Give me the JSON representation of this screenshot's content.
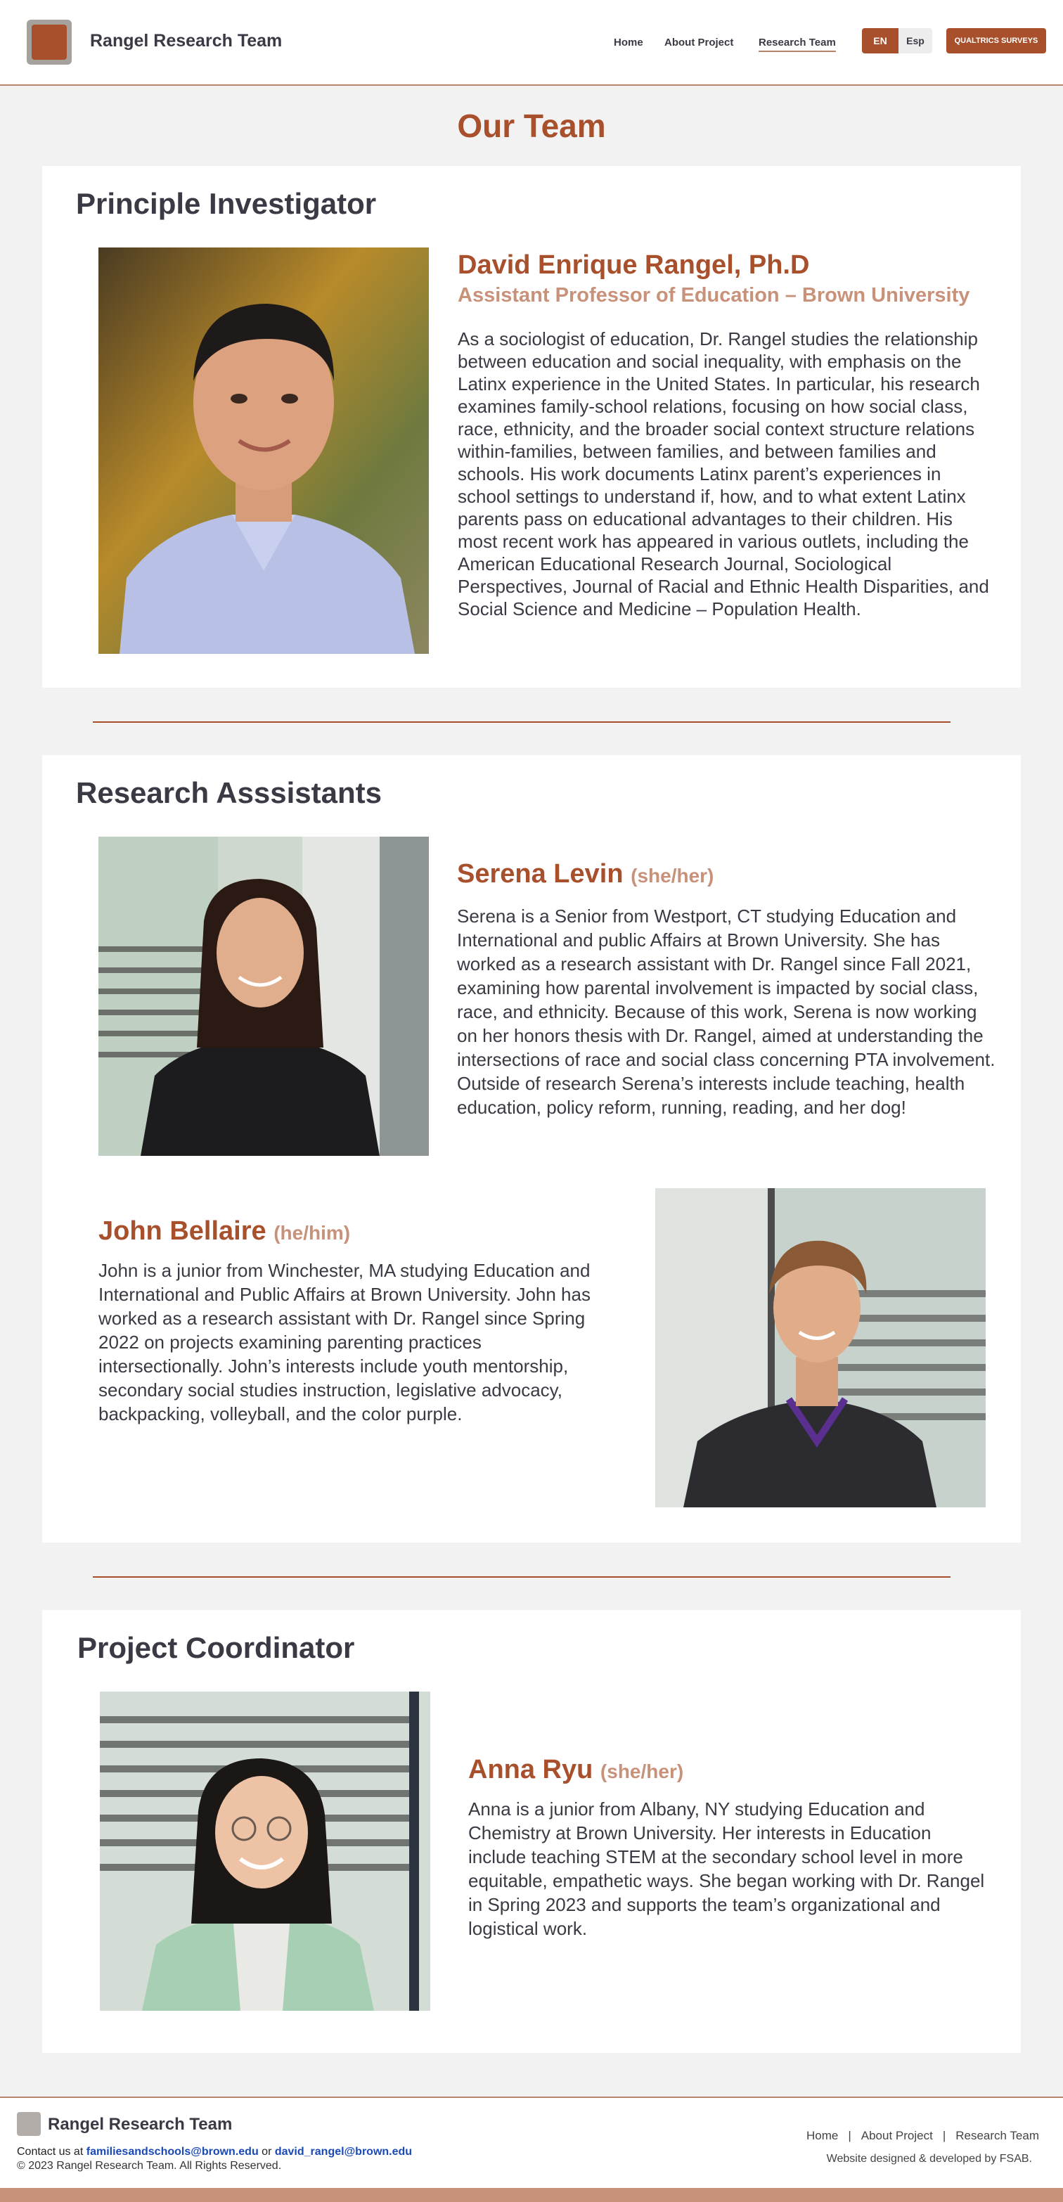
{
  "header": {
    "brand": "Rangel Research Team",
    "nav": [
      {
        "label": "Home"
      },
      {
        "label": "About Project"
      },
      {
        "label": "Research Team"
      }
    ],
    "active_nav": "Research Team",
    "lang_en": "EN",
    "lang_es": "Esp",
    "surveys_button": "QUALTRICS SURVEYS"
  },
  "page": {
    "title": "Our Team"
  },
  "pi_section": {
    "heading": "Principle Investigator",
    "name": "David Enrique Rangel, Ph.D",
    "role": "Assistant Professor of Education – Brown University",
    "bio": "As a sociologist of education, Dr. Rangel studies the relationship between education and social inequality, with emphasis on the Latinx experience in the United States. In particular, his research examines family-school relations, focusing on how social class, race, ethnicity, and the broader social context structure relations within-families, between families, and between families and schools. His work documents Latinx parent’s experiences in school settings to understand if, how, and to what extent Latinx parents pass on educational advantages to their children. His most recent work has appeared in various outlets, including the American Educational Research Journal, Sociological Perspectives, Journal of Racial and Ethnic Health Disparities, and Social Science and Medicine – Population Health."
  },
  "ra_section": {
    "heading": "Research Asssistants",
    "members": [
      {
        "name": "Serena Levin",
        "pronouns": "(she/her)",
        "bio": "Serena is a Senior from Westport, CT studying Education and International and public Affairs at Brown University. She has worked as a research assistant with Dr. Rangel since Fall 2021, examining how parental involvement is impacted by social class, race, and ethnicity. Because of this work, Serena is now working on her honors thesis with Dr. Rangel, aimed at understanding the intersections of race and social class concerning PTA involvement. Outside of research Serena’s interests include teaching, health education, policy reform, running, reading, and her dog!"
      },
      {
        "name": "John Bellaire",
        "pronouns": "(he/him)",
        "bio": "John is a junior from Winchester, MA studying Education and International and Public Affairs at Brown University. John has worked as a research assistant with Dr. Rangel since Spring 2022 on projects examining parenting practices intersectionally. John’s interests include youth mentorship, secondary social studies instruction, legislative advocacy, backpacking, volleyball, and the color purple."
      }
    ]
  },
  "pc_section": {
    "heading": "Project Coordinator",
    "name": "Anna Ryu",
    "pronouns": "(she/her)",
    "bio": "Anna is a junior from Albany, NY studying Education and Chemistry at Brown University. Her interests in Education include teaching STEM at the secondary school level in more equitable, empathetic ways. She began working with Dr. Rangel in Spring 2023 and supports the team’s organizational and logistical work."
  },
  "footer": {
    "brand": "Rangel Research Team",
    "contact_prefix": "Contact us at",
    "email_1": "familiesandschools@brown.edu",
    "contact_or": "or",
    "email_2": "david_rangel@brown.edu",
    "copyright": "© 2023 Rangel Research Team. All Rights Reserved.",
    "links": [
      "Home",
      "About Project",
      "Research Team"
    ],
    "separator": "|",
    "credit": "Website designed & developed by FSAB."
  },
  "colors": {
    "accent": "#a84f2c",
    "accent_light": "#c8917a",
    "text_dark": "#3a3a45",
    "background": "#f2f2f2",
    "link": "#1a49b8"
  }
}
